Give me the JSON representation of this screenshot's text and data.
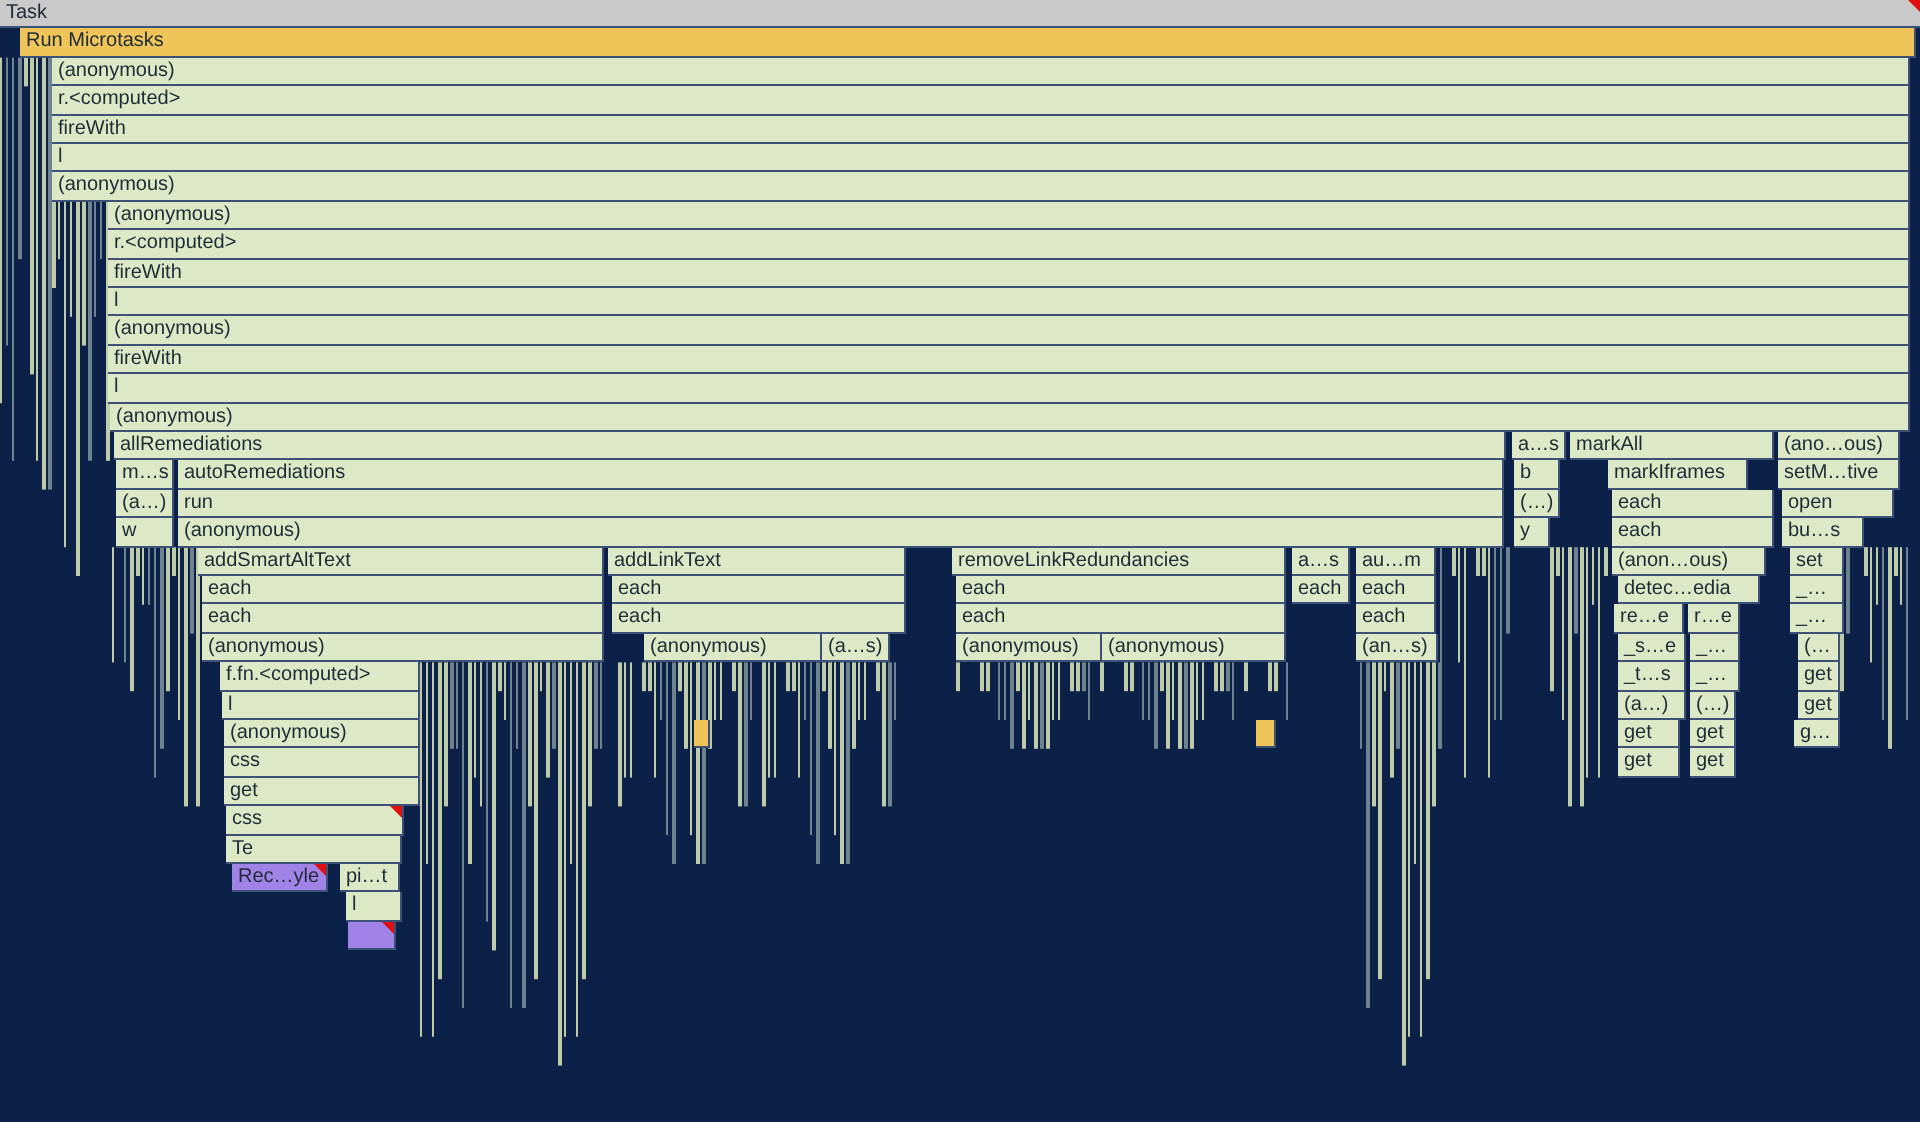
{
  "flame_chart": {
    "rows": [
      {
        "frames": [
          {
            "label": "Task",
            "kind": "task",
            "warning": true
          }
        ]
      },
      {
        "frames": [
          {
            "label": "Run Microtasks",
            "kind": "microtask",
            "warning": false
          }
        ]
      },
      {
        "frames": [
          {
            "label": "(anonymous)",
            "kind": "function",
            "warning": false
          }
        ]
      },
      {
        "frames": [
          {
            "label": "r.<computed>",
            "kind": "function",
            "warning": false
          }
        ]
      },
      {
        "frames": [
          {
            "label": "fireWith",
            "kind": "function",
            "warning": false
          }
        ]
      },
      {
        "frames": [
          {
            "label": "l",
            "kind": "function",
            "warning": false
          }
        ]
      },
      {
        "frames": [
          {
            "label": "(anonymous)",
            "kind": "function",
            "warning": false
          }
        ]
      },
      {
        "frames": [
          {
            "label": "(anonymous)",
            "kind": "function",
            "warning": false
          }
        ]
      },
      {
        "frames": [
          {
            "label": "r.<computed>",
            "kind": "function",
            "warning": false
          }
        ]
      },
      {
        "frames": [
          {
            "label": "fireWith",
            "kind": "function",
            "warning": false
          }
        ]
      },
      {
        "frames": [
          {
            "label": "l",
            "kind": "function",
            "warning": false
          }
        ]
      },
      {
        "frames": [
          {
            "label": "(anonymous)",
            "kind": "function",
            "warning": false
          }
        ]
      },
      {
        "frames": [
          {
            "label": "fireWith",
            "kind": "function",
            "warning": false
          }
        ]
      },
      {
        "frames": [
          {
            "label": "l",
            "kind": "function",
            "warning": false
          }
        ]
      },
      {
        "frames": [
          {
            "label": "(anonymous)",
            "kind": "function",
            "warning": false
          }
        ]
      },
      {
        "frames": [
          {
            "label": "allRemediations",
            "kind": "function",
            "warning": false
          },
          {
            "label": "a…s",
            "kind": "function",
            "warning": false
          },
          {
            "label": "markAll",
            "kind": "function",
            "warning": false
          },
          {
            "label": "(ano…ous)",
            "kind": "function",
            "warning": false
          }
        ]
      },
      {
        "frames": [
          {
            "label": "m…s",
            "kind": "function",
            "warning": false
          },
          {
            "label": "autoRemediations",
            "kind": "function",
            "warning": false
          },
          {
            "label": "b",
            "kind": "function",
            "warning": false
          },
          {
            "label": "markIframes",
            "kind": "function",
            "warning": false
          },
          {
            "label": "setM…tive",
            "kind": "function",
            "warning": false
          }
        ]
      },
      {
        "frames": [
          {
            "label": "(a…)",
            "kind": "function",
            "warning": false
          },
          {
            "label": "run",
            "kind": "function",
            "warning": false
          },
          {
            "label": "(…)",
            "kind": "function",
            "warning": false
          },
          {
            "label": "each",
            "kind": "function",
            "warning": false
          },
          {
            "label": "open",
            "kind": "function",
            "warning": false
          }
        ]
      },
      {
        "frames": [
          {
            "label": "w",
            "kind": "function",
            "warning": false
          },
          {
            "label": "(anonymous)",
            "kind": "function",
            "warning": false
          },
          {
            "label": "y",
            "kind": "function",
            "warning": false
          },
          {
            "label": "each",
            "kind": "function",
            "warning": false
          },
          {
            "label": "bu…s",
            "kind": "function",
            "warning": false
          }
        ]
      },
      {
        "frames": [
          {
            "label": "addSmartAltText",
            "kind": "function",
            "warning": false
          },
          {
            "label": "addLinkText",
            "kind": "function",
            "warning": false
          },
          {
            "label": "removeLinkRedundancies",
            "kind": "function",
            "warning": false
          },
          {
            "label": "a…s",
            "kind": "function",
            "warning": false
          },
          {
            "label": "au…m",
            "kind": "function",
            "warning": false
          },
          {
            "label": "(anon…ous)",
            "kind": "function",
            "warning": false
          },
          {
            "label": "set",
            "kind": "function",
            "warning": false
          }
        ]
      },
      {
        "frames": [
          {
            "label": "each",
            "kind": "function",
            "warning": false
          },
          {
            "label": "each",
            "kind": "function",
            "warning": false
          },
          {
            "label": "each",
            "kind": "function",
            "warning": false
          },
          {
            "label": "each",
            "kind": "function",
            "warning": false
          },
          {
            "label": "each",
            "kind": "function",
            "warning": false
          },
          {
            "label": "detec…edia",
            "kind": "function",
            "warning": false
          },
          {
            "label": "_…",
            "kind": "function",
            "warning": false
          }
        ]
      },
      {
        "frames": [
          {
            "label": "each",
            "kind": "function",
            "warning": false
          },
          {
            "label": "each",
            "kind": "function",
            "warning": false
          },
          {
            "label": "each",
            "kind": "function",
            "warning": false
          },
          {
            "label": "each",
            "kind": "function",
            "warning": false
          },
          {
            "label": "re…e",
            "kind": "function",
            "warning": false
          },
          {
            "label": "r…e",
            "kind": "function",
            "warning": false
          },
          {
            "label": "_…",
            "kind": "function",
            "warning": false
          }
        ]
      },
      {
        "frames": [
          {
            "label": "(anonymous)",
            "kind": "function",
            "warning": false
          },
          {
            "label": "(anonymous)",
            "kind": "function",
            "warning": false
          },
          {
            "label": "(a…s)",
            "kind": "function",
            "warning": false
          },
          {
            "label": "(anonymous)",
            "kind": "function",
            "warning": false
          },
          {
            "label": "(anonymous)",
            "kind": "function",
            "warning": false
          },
          {
            "label": "(an…s)",
            "kind": "function",
            "warning": false
          },
          {
            "label": "_s…e",
            "kind": "function",
            "warning": false
          },
          {
            "label": "_…",
            "kind": "function",
            "warning": false
          },
          {
            "label": "(…",
            "kind": "function",
            "warning": false
          }
        ]
      },
      {
        "frames": [
          {
            "label": "f.fn.<computed>",
            "kind": "function",
            "warning": false
          },
          {
            "label": "_t…s",
            "kind": "function",
            "warning": false
          },
          {
            "label": "_…",
            "kind": "function",
            "warning": false
          },
          {
            "label": "get",
            "kind": "function",
            "warning": false
          }
        ]
      },
      {
        "frames": [
          {
            "label": "l",
            "kind": "function",
            "warning": false
          },
          {
            "label": "(a…)",
            "kind": "function",
            "warning": false
          },
          {
            "label": "(…)",
            "kind": "function",
            "warning": false
          },
          {
            "label": "get",
            "kind": "function",
            "warning": false
          }
        ]
      },
      {
        "frames": [
          {
            "label": "(anonymous)",
            "kind": "function",
            "warning": false
          },
          {
            "kind": "microtask",
            "warning": false
          },
          {
            "kind": "microtask",
            "warning": false
          },
          {
            "label": "get",
            "kind": "function",
            "warning": false
          },
          {
            "label": "get",
            "kind": "function",
            "warning": false
          },
          {
            "label": "g…",
            "kind": "function",
            "warning": false
          }
        ]
      },
      {
        "frames": [
          {
            "label": "css",
            "kind": "function",
            "warning": false
          },
          {
            "label": "get",
            "kind": "function",
            "warning": false
          },
          {
            "label": "get",
            "kind": "function",
            "warning": false
          }
        ]
      },
      {
        "frames": [
          {
            "label": "get",
            "kind": "function",
            "warning": false
          }
        ]
      },
      {
        "frames": [
          {
            "label": "css",
            "kind": "function",
            "warning": true
          }
        ]
      },
      {
        "frames": [
          {
            "label": "Te",
            "kind": "function",
            "warning": false
          }
        ]
      },
      {
        "frames": [
          {
            "label": "Rec…yle",
            "kind": "rendering",
            "warning": true
          },
          {
            "label": "pi…t",
            "kind": "function",
            "warning": false
          }
        ]
      },
      {
        "frames": [
          {
            "label": "l",
            "kind": "function",
            "warning": false
          }
        ]
      },
      {
        "frames": [
          {
            "kind": "rendering",
            "warning": true
          }
        ]
      }
    ]
  }
}
